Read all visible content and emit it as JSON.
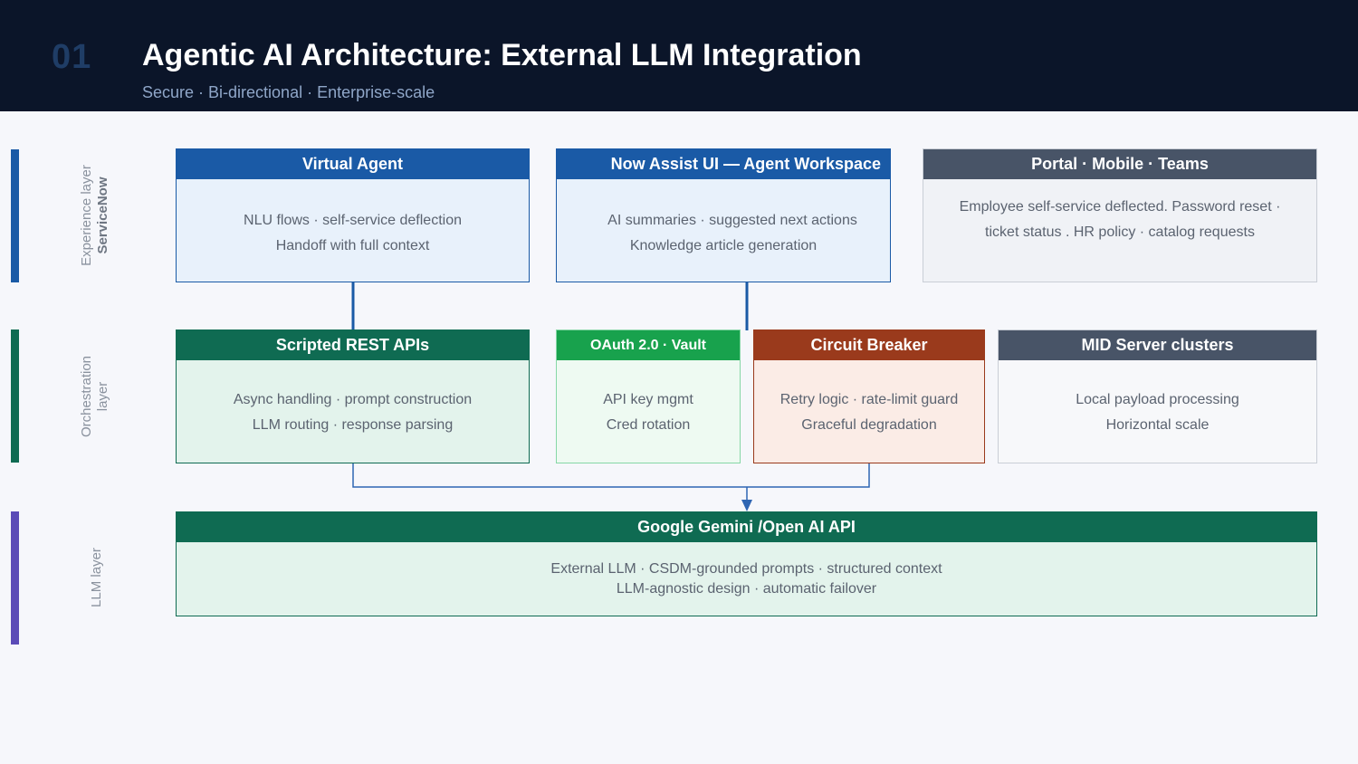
{
  "header": {
    "slide_number": "01",
    "title": "Agentic AI Architecture: External LLM Integration",
    "subtitle": "Secure · Bi-directional · Enterprise-scale"
  },
  "layers": {
    "experience": {
      "line1": "Experience layer",
      "line2": "ServiceNow",
      "color": "#1a5aa6"
    },
    "orchestration": {
      "line1": "Orchestration",
      "line2": "layer",
      "color": "#0f6b52"
    },
    "llm": {
      "line1": "LLM layer",
      "color": "#5b4bb7"
    }
  },
  "experience": {
    "virtual_agent": {
      "title": "Virtual Agent",
      "line1": "NLU flows · self-service deflection",
      "line2": "Handoff with full context"
    },
    "now_assist": {
      "title": "Now Assist UI — Agent Workspace",
      "line1": "AI summaries · suggested next actions",
      "line2": "Knowledge article generation"
    },
    "portal": {
      "title": "Portal · Mobile · Teams",
      "line1": "Employee self-service deflected. Password reset ·",
      "line2": "ticket status . HR policy · catalog requests"
    }
  },
  "orchestration": {
    "scripted_rest": {
      "title": "Scripted REST APIs",
      "line1": "Async handling · prompt construction",
      "line2": "LLM routing · response parsing"
    },
    "oauth": {
      "title": "OAuth 2.0 · Vault",
      "line1": "API key mgmt",
      "line2": "Cred rotation"
    },
    "circuit_breaker": {
      "title": "Circuit Breaker",
      "line1": "Retry logic · rate-limit guard",
      "line2": "Graceful degradation"
    },
    "mid_server": {
      "title": "MID Server clusters",
      "line1": "Local payload processing",
      "line2": "Horizontal scale"
    }
  },
  "llm": {
    "gemini": {
      "title": "Google Gemini /Open AI API",
      "line1": "External LLM · CSDM-grounded prompts · structured context",
      "line2": "LLM-agnostic design · automatic failover"
    }
  }
}
